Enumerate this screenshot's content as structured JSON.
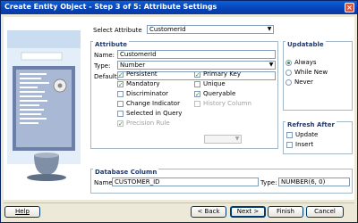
{
  "window": {
    "title": "Create Entity Object - Step 3 of 5: Attribute Settings",
    "close_glyph": "×"
  },
  "select_attribute": {
    "label": "Select Attribute",
    "value": "CustomerId"
  },
  "attribute": {
    "title": "Attribute",
    "name_label": "Name:",
    "name_value": "CustomerId",
    "type_label": "Type:",
    "type_value": "Number",
    "default_label": "Default:",
    "default_value": "",
    "checks": [
      {
        "label": "Persistent",
        "checked": true,
        "disabled": false
      },
      {
        "label": "Mandatory",
        "checked": true,
        "disabled": false
      },
      {
        "label": "Discriminator",
        "checked": false,
        "disabled": false
      },
      {
        "label": "Change Indicator",
        "checked": false,
        "disabled": false
      },
      {
        "label": "Selected in Query",
        "checked": false,
        "disabled": false
      },
      {
        "label": "Precision Rule",
        "checked": true,
        "disabled": true
      },
      {
        "label": "Primary Key",
        "checked": true,
        "disabled": false
      },
      {
        "label": "Unique",
        "checked": false,
        "disabled": false
      },
      {
        "label": "Queryable",
        "checked": true,
        "disabled": false
      },
      {
        "label": "History Column",
        "checked": false,
        "disabled": true
      }
    ]
  },
  "updatable": {
    "title": "Updatable",
    "options": [
      "Always",
      "While New",
      "Never"
    ],
    "selected": "Always"
  },
  "refresh_after": {
    "title": "Refresh After",
    "options": [
      "Update",
      "Insert"
    ]
  },
  "database_column": {
    "title": "Database Column",
    "name_label": "Name:",
    "name_value": "CUSTOMER_ID",
    "type_label": "Type:",
    "type_value": "NUMBER(6, 0)"
  },
  "buttons": {
    "help": "Help",
    "back": "< Back",
    "next": "Next >",
    "finish": "Finish",
    "cancel": "Cancel"
  },
  "colors": {
    "title_bar": "#0a47c2",
    "group_title": "#1f3b73",
    "check_mark": "#21a121"
  }
}
